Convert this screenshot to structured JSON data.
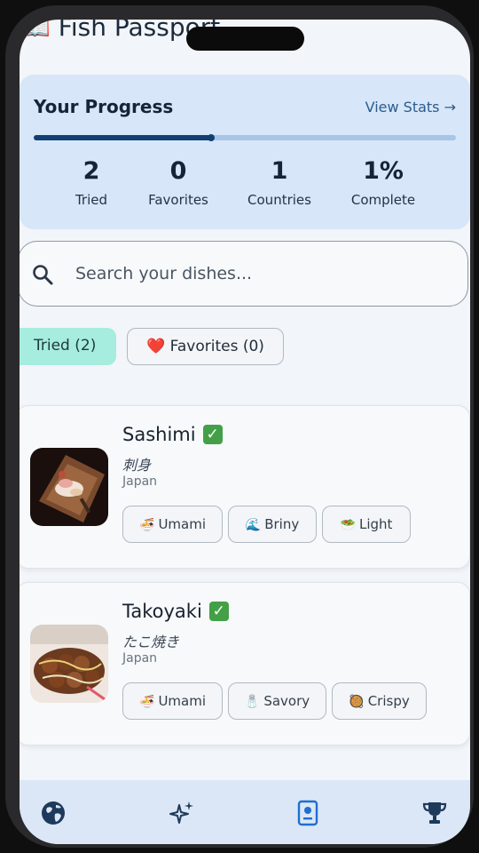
{
  "app": {
    "title_emoji": "📖",
    "title": "Fish Passport"
  },
  "progress": {
    "title": "Your Progress",
    "view_stats": "View Stats →",
    "fraction": 0.42,
    "stats": [
      {
        "value": "2",
        "label": "Tried"
      },
      {
        "value": "0",
        "label": "Favorites"
      },
      {
        "value": "1",
        "label": "Countries"
      },
      {
        "value": "1%",
        "label": "Complete"
      }
    ]
  },
  "search": {
    "placeholder": "Search your dishes..."
  },
  "filters": {
    "tried": "Tried (2)",
    "favorites": "❤️ Favorites (0)"
  },
  "dishes": [
    {
      "name": "Sashimi",
      "verified": "✓",
      "native": "刺身",
      "country": "Japan",
      "tags": [
        {
          "emoji": "🍜",
          "label": "Umami"
        },
        {
          "emoji": "🌊",
          "label": "Briny"
        },
        {
          "emoji": "🥗",
          "label": "Light"
        }
      ]
    },
    {
      "name": "Takoyaki",
      "verified": "✓",
      "native": "たこ焼き",
      "country": "Japan",
      "tags": [
        {
          "emoji": "🍜",
          "label": "Umami"
        },
        {
          "emoji": "🧂",
          "label": "Savory"
        },
        {
          "emoji": "🥘",
          "label": "Crispy"
        }
      ]
    }
  ],
  "nav": {
    "active": "passport-icon",
    "items": [
      "globe-icon",
      "sparkles-icon",
      "passport-icon",
      "trophy-icon"
    ]
  },
  "colors": {
    "accent": "#123f73",
    "progress_bg": "#d7e6f8",
    "tried_chip": "#a6ecdf",
    "check": "#43a047"
  }
}
